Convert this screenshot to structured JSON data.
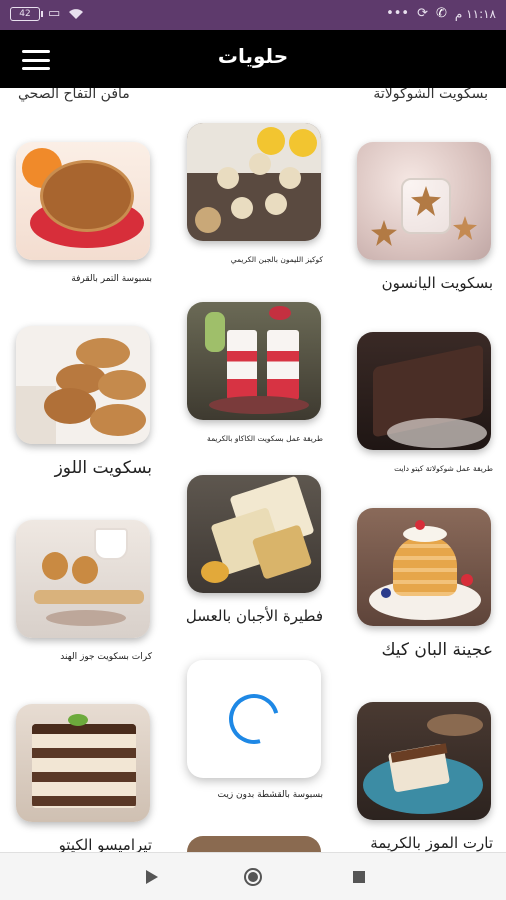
{
  "status_bar": {
    "battery": "42",
    "time": "١١:١٨ م"
  },
  "header": {
    "title": "حلويات"
  },
  "top_partial": {
    "left": "مافن التفاح الصحي",
    "right": "بسكويت الشوكولاتة"
  },
  "cards": {
    "c1": "بسبوسة التمر بالقرفة",
    "c2": "كوكيز الليمون بالجبن الكريمي",
    "c3": "بسكويت اليانسون",
    "c4": "بسكويت اللوز",
    "c5": "طريقة عمل بسكويت الكاكاو بالكريمة",
    "c6": "طريقة عمل شوكولاتة كيتو دايت",
    "c7": "كرات بسكويت جوز الهند",
    "c8": "فطيرة الأجبان بالعسل",
    "c9": "عجينة البان كيك",
    "c10": "تيراميسو الكيتو",
    "c11": "بسبوسة بالقشطة بدون زيت",
    "c12": "تارت الموز بالكريمة"
  },
  "colors": {
    "status_bar": "#5e3a6c",
    "app_bar": "#000000",
    "spinner": "#1e88e5"
  }
}
